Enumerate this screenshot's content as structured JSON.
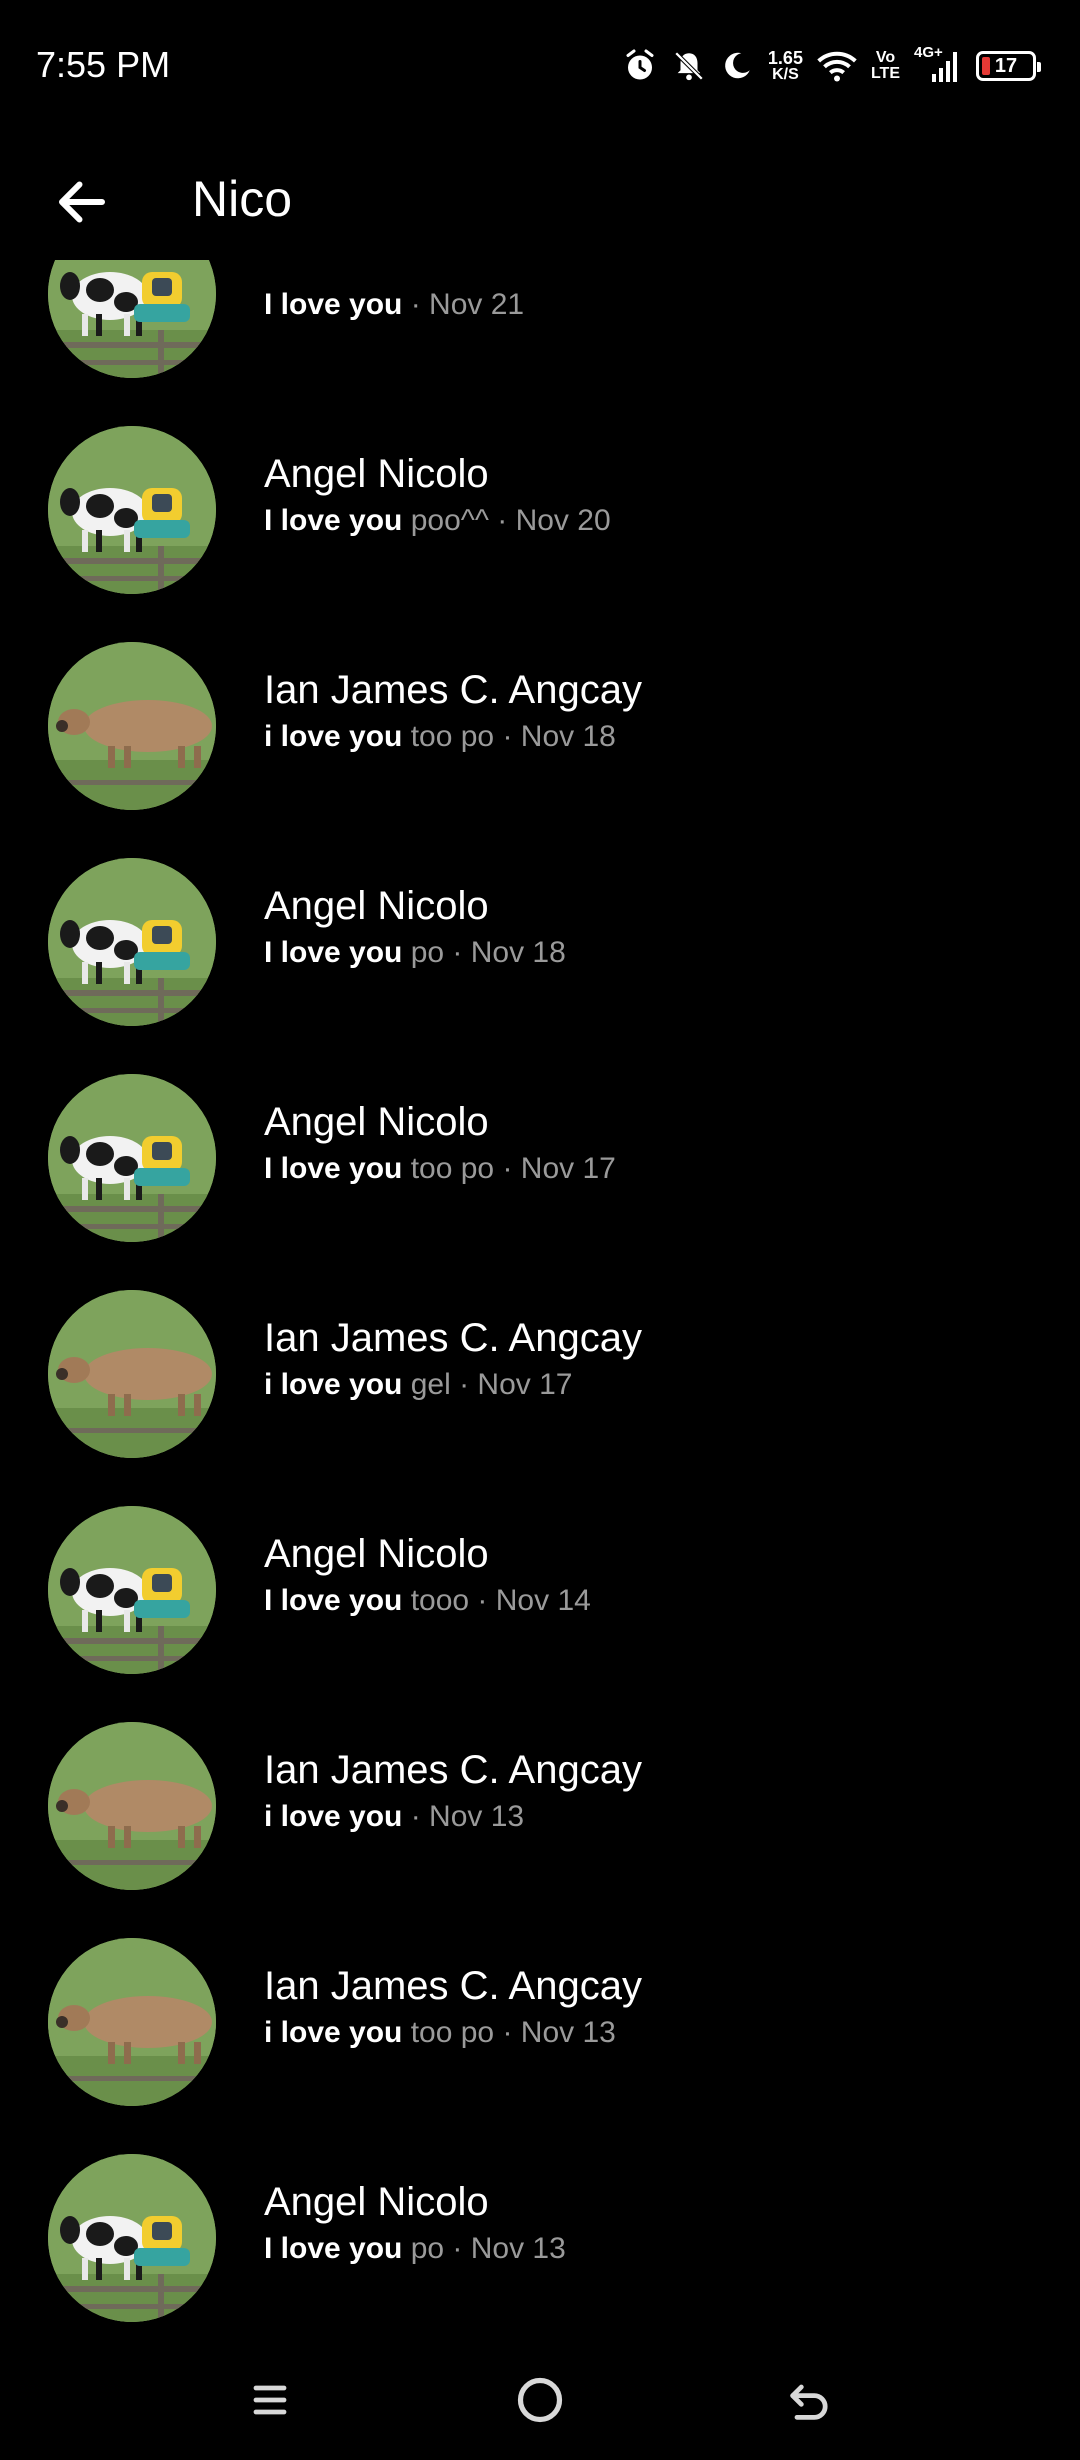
{
  "status_bar": {
    "time": "7:55 PM",
    "speed_value": "1.65",
    "speed_unit": "K/S",
    "volte_top": "Vo",
    "volte_bottom": "LTE",
    "network": "4G+",
    "battery": "17",
    "battery_color": "#e53935"
  },
  "header": {
    "title": "Nico",
    "back_icon": "arrow-left-icon"
  },
  "messages": [
    {
      "name": "",
      "highlight": "I love you",
      "rest": " · Nov 21",
      "avatar": "cow-holstein-avatar"
    },
    {
      "name": "Angel Nicolo",
      "highlight": "I love you",
      "rest": " poo^^ · Nov 20",
      "avatar": "cow-holstein-avatar"
    },
    {
      "name": "Ian James C. Angcay",
      "highlight": "i love you",
      "rest": " too po · Nov 18",
      "avatar": "cow-jersey-avatar"
    },
    {
      "name": "Angel Nicolo",
      "highlight": "I love you",
      "rest": " po · Nov 18",
      "avatar": "cow-holstein-avatar"
    },
    {
      "name": "Angel Nicolo",
      "highlight": "I love you",
      "rest": " too po · Nov 17",
      "avatar": "cow-holstein-avatar"
    },
    {
      "name": "Ian James C. Angcay",
      "highlight": "i love you",
      "rest": " gel · Nov 17",
      "avatar": "cow-jersey-avatar"
    },
    {
      "name": "Angel Nicolo",
      "highlight": "I love you",
      "rest": " tooo · Nov 14",
      "avatar": "cow-holstein-avatar"
    },
    {
      "name": "Ian James C. Angcay",
      "highlight": "i love you",
      "rest": " · Nov 13",
      "avatar": "cow-jersey-avatar"
    },
    {
      "name": "Ian James C. Angcay",
      "highlight": "i love you",
      "rest": " too po · Nov 13",
      "avatar": "cow-jersey-avatar"
    },
    {
      "name": "Angel Nicolo",
      "highlight": "I love you",
      "rest": " po · Nov 13",
      "avatar": "cow-holstein-avatar"
    }
  ],
  "nav": {
    "menu_icon": "menu-icon",
    "home_icon": "home-circle-icon",
    "back_icon": "back-arrow-icon"
  }
}
